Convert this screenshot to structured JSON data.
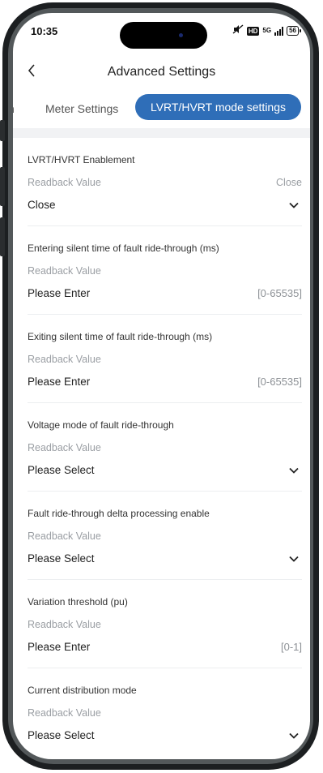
{
  "status_bar": {
    "time": "10:35",
    "network": "5G",
    "battery": "56",
    "hd": "HD"
  },
  "header": {
    "title": "Advanced Settings"
  },
  "tabs": [
    {
      "label": "n"
    },
    {
      "label": "Meter Settings"
    },
    {
      "label": "LVRT/HVRT mode settings",
      "active": true
    }
  ],
  "fields": [
    {
      "title": "LVRT/HVRT Enablement",
      "readback_label": "Readback Value",
      "readback_value": "Close",
      "value": "Close",
      "type": "select"
    },
    {
      "title": "Entering silent time of fault ride-through (ms)",
      "readback_label": "Readback Value",
      "readback_value": "",
      "value": "Please Enter",
      "range": "[0-65535]",
      "type": "input"
    },
    {
      "title": "Exiting silent time of fault ride-through (ms)",
      "readback_label": "Readback Value",
      "readback_value": "",
      "value": "Please Enter",
      "range": "[0-65535]",
      "type": "input"
    },
    {
      "title": "Voltage mode of fault ride-through",
      "readback_label": "Readback Value",
      "readback_value": "",
      "value": "Please Select",
      "type": "select"
    },
    {
      "title": "Fault ride-through delta processing enable",
      "readback_label": "Readback Value",
      "readback_value": "",
      "value": "Please Select",
      "type": "select"
    },
    {
      "title": "Variation threshold (pu)",
      "readback_label": "Readback Value",
      "readback_value": "",
      "value": "Please Enter",
      "range": "[0-1]",
      "type": "input"
    },
    {
      "title": "Current distribution mode",
      "readback_label": "Readback Value",
      "readback_value": "",
      "value": "Please Select",
      "type": "select"
    }
  ],
  "colors": {
    "accent": "#2f6eb8",
    "muted_text": "#9a9ea3",
    "divider": "#eceef0"
  }
}
